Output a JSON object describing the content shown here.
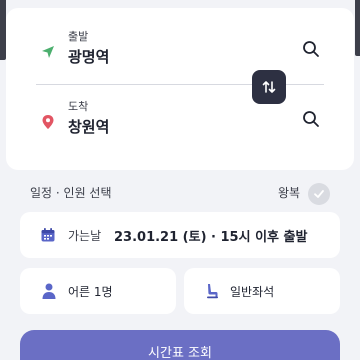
{
  "departure": {
    "small_label": "출발",
    "station": "광명역"
  },
  "arrival": {
    "small_label": "도착",
    "station": "창원역"
  },
  "schedule": {
    "section_title": "일정 · 인원 선택",
    "roundtrip_label": "왕복",
    "date_label": "가는날",
    "date_value": "23.01.21 (토) · 15시 이후 출발"
  },
  "passengers": {
    "label": "어른 1명"
  },
  "seat": {
    "label": "일반좌석"
  },
  "search_button": {
    "label": "시간표 조회"
  },
  "colors": {
    "departure_icon": "#4caf6e",
    "arrival_icon": "#e25563",
    "primary_button": "#6b6fc4",
    "swap_button": "#2d3042",
    "accent_icons": "#5a66c8"
  },
  "icons": {
    "departure": "navigation-arrow-icon",
    "arrival": "map-pin-icon",
    "search": "search-icon",
    "swap": "swap-vertical-icon",
    "roundtrip": "check-icon",
    "date": "calendar-icon",
    "passengers": "person-icon",
    "seat": "seat-icon"
  }
}
